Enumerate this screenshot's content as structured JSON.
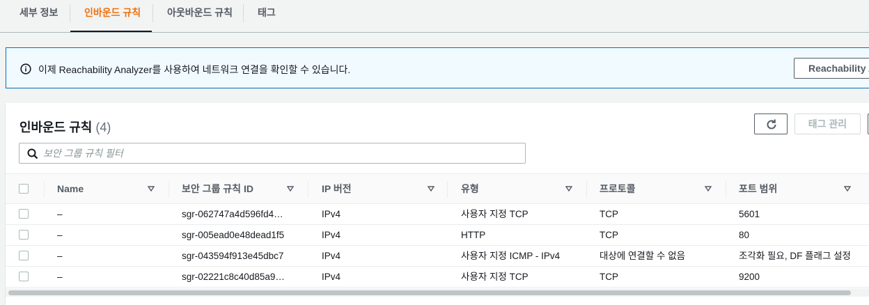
{
  "tabs": [
    {
      "label": "세부 정보",
      "active": false
    },
    {
      "label": "인바운드 규칙",
      "active": true
    },
    {
      "label": "아웃바운드 규칙",
      "active": false
    },
    {
      "label": "태그",
      "active": false
    }
  ],
  "banner": {
    "message": "이제 Reachability Analyzer를 사용하여 네트워크 연결을 확인할 수 있습니다.",
    "button_label": "Reachability Analyzer"
  },
  "panel": {
    "title": "인바운드 규칙",
    "count": "(4)",
    "tag_button": "태그 관리",
    "filter_placeholder": "보안 그룹 규칙 필터"
  },
  "table": {
    "columns": [
      "Name",
      "보안 그룹 규칙 ID",
      "IP 버전",
      "유형",
      "프로토콜",
      "포트 범위"
    ],
    "rows": [
      [
        "–",
        "sgr-062747a4d596fd4…",
        "IPv4",
        "사용자 지정 TCP",
        "TCP",
        "5601"
      ],
      [
        "–",
        "sgr-005ead0e48dead1f5",
        "IPv4",
        "HTTP",
        "TCP",
        "80"
      ],
      [
        "–",
        "sgr-043594f913e45dbc7",
        "IPv4",
        "사용자 지정 ICMP - IPv4",
        "대상에 연결할 수 없음",
        "조각화 필요, DF 플래그 설정"
      ],
      [
        "–",
        "sgr-02221c8c40d85a9…",
        "IPv4",
        "사용자 지정 TCP",
        "TCP",
        "9200"
      ]
    ]
  },
  "colors": {
    "accent": "#ec7211",
    "info": "#0073bb"
  }
}
